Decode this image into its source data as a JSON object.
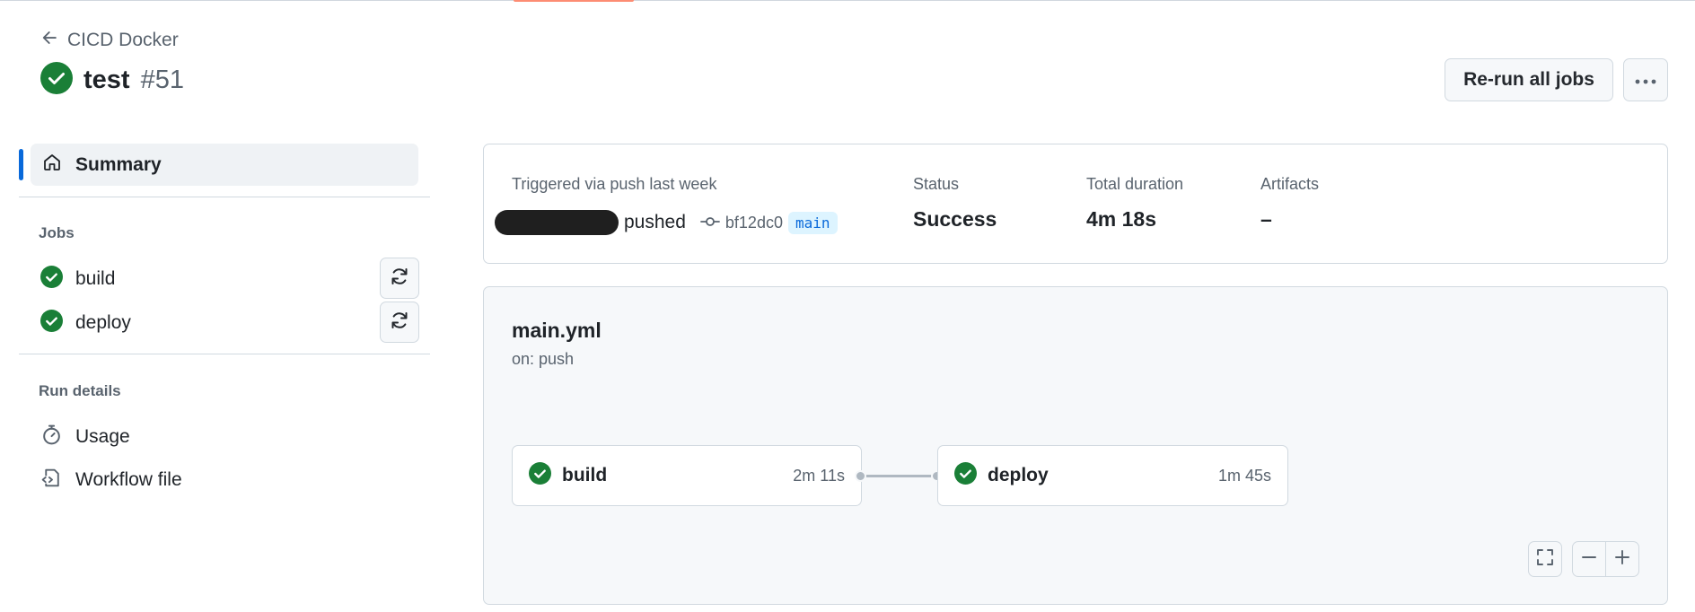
{
  "header": {
    "back_label": "CICD Docker",
    "run_name": "test",
    "run_number": "#51",
    "rerun_label": "Re-run all jobs"
  },
  "sidebar": {
    "summary_label": "Summary",
    "jobs_heading": "Jobs",
    "jobs": [
      {
        "label": "build"
      },
      {
        "label": "deploy"
      }
    ],
    "run_details_heading": "Run details",
    "usage_label": "Usage",
    "workflow_file_label": "Workflow file"
  },
  "summary": {
    "trigger_text": "Triggered via push last week",
    "action_text": "pushed",
    "commit_sha": "bf12dc0",
    "branch": "main",
    "status_label": "Status",
    "status_value": "Success",
    "duration_label": "Total duration",
    "duration_value": "4m 18s",
    "artifacts_label": "Artifacts",
    "artifacts_value": "–"
  },
  "workflow": {
    "file_name": "main.yml",
    "trigger": "on: push",
    "jobs": [
      {
        "name": "build",
        "duration": "2m 11s"
      },
      {
        "name": "deploy",
        "duration": "1m 45s"
      }
    ]
  },
  "colors": {
    "success": "#1a7f37",
    "accent": "#0969da"
  }
}
